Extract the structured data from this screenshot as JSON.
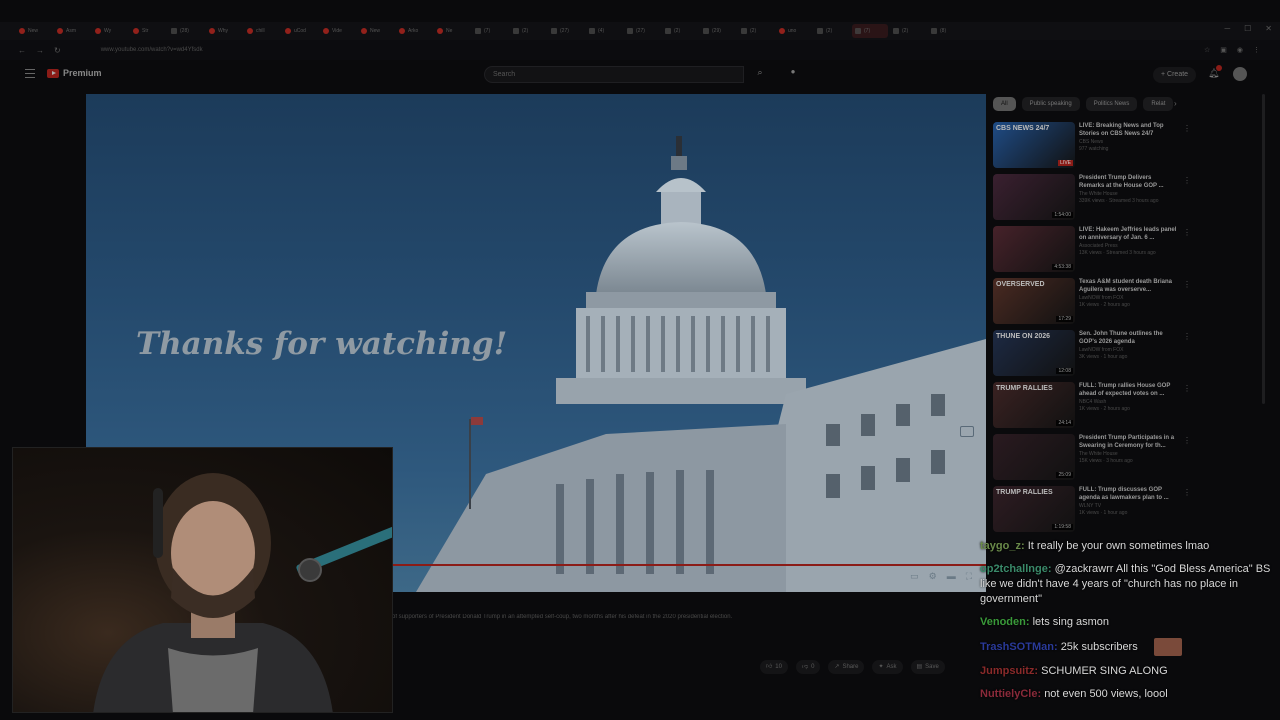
{
  "browser": {
    "tabs": [
      "New",
      "Asm",
      "Wy",
      "Str",
      "(28)",
      "Why",
      "chill",
      "uCod",
      "Vide",
      "New",
      "Arko",
      "Ne",
      "(7)",
      "(2)",
      "(27)",
      "(4)",
      "(27)",
      "(2)",
      "(29)",
      "(2)",
      "uno",
      "(2)",
      "(7)",
      "(2)",
      "(8)"
    ],
    "url": "www.youtube.com/watch?v=wd4Yfsdk"
  },
  "youtube": {
    "logo": "Premium",
    "search_placeholder": "Search",
    "create_label": "Create"
  },
  "player": {
    "endcard_text": "Thanks for watching!",
    "description": "of supporters of President Donald Trump in an attempted self-coup, two months after his defeat in the 2020 presidential election.",
    "progress": 1.0
  },
  "actions": {
    "like_count": "10",
    "dislike_label": "0",
    "share": "Share",
    "ask": "Ask",
    "save": "Save"
  },
  "chips": [
    "All",
    "Public speaking",
    "Politics News",
    "Relat"
  ],
  "recommendations": [
    {
      "thumb_label": "CBS NEWS 24/7",
      "badge": "LIVE",
      "title": "LIVE: Breaking News and Top Stories on CBS News 24/7",
      "channel": "CBS News",
      "meta": "977 watching",
      "thumb_color": "#1f4c86"
    },
    {
      "thumb_label": "",
      "badge": "1:54:00",
      "title": "President Trump Delivers Remarks at the House GOP ...",
      "channel": "The White House",
      "meta": "339K views · Streamed 3 hours ago",
      "thumb_color": "#3a2030"
    },
    {
      "thumb_label": "",
      "badge": "4:53:38",
      "title": "LIVE: Hakeem Jeffries leads panel on anniversary of Jan. 6 ...",
      "channel": "Associated Press",
      "meta": "13K views · Streamed 3 hours ago",
      "thumb_color": "#46222a"
    },
    {
      "thumb_label": "OVERSERVED",
      "badge": "17:29",
      "title": "Texas A&M student death Briana Aguilera was overserve...",
      "channel": "LawNOW from FOX",
      "meta": "1K views · 2 hours ago",
      "thumb_color": "#4a2a22"
    },
    {
      "thumb_label": "THUNE ON 2026",
      "badge": "12:08",
      "title": "Sen. John Thune outlines the GOP's 2026 agenda",
      "channel": "LawNOW from FOX",
      "meta": "3K views · 1 hour ago",
      "thumb_color": "#1d2a44"
    },
    {
      "thumb_label": "TRUMP RALLIES",
      "badge": "24:14",
      "title": "FULL: Trump rallies House GOP ahead of expected votes on ...",
      "channel": "NBC4 Wash",
      "meta": "1K views · 2 hours ago",
      "thumb_color": "#3a2222"
    },
    {
      "thumb_label": "",
      "badge": "25:09",
      "title": "President Trump Participates in a Swearing in Ceremony for th...",
      "channel": "The White House",
      "meta": "15K views · 3 hours ago",
      "thumb_color": "#2a1a20"
    },
    {
      "thumb_label": "TRUMP RALLIES",
      "badge": "1:19:58",
      "title": "FULL: Trump discusses GOP agenda as lawmakers plan to ...",
      "channel": "WLNY TV",
      "meta": "1K views · 1 hour ago",
      "thumb_color": "#2e1c22"
    }
  ],
  "chat": [
    {
      "user": "taygo_z:",
      "text": "It really be your own sometimes lmao",
      "color": "#6a8a4a"
    },
    {
      "user": "op2tchallnge:",
      "text": "@zackrawrr All this \"God Bless America\" BS like we didn't have 4 years of \"church has no place in government\"",
      "color": "#3a8a6a"
    },
    {
      "user": "Venoden:",
      "text": "lets sing asmon",
      "color": "#3a9a3a"
    },
    {
      "user": "TrashSOTMan:",
      "text": "25k subscribers",
      "color": "#2a3a9a"
    },
    {
      "user": "Jumpsuitz:",
      "text": "SCHUMER SING ALONG",
      "color": "#8a2a2a"
    },
    {
      "user": "NuttielyCle:",
      "text": "not even 500 views, loool",
      "color": "#8a2a3a"
    }
  ]
}
